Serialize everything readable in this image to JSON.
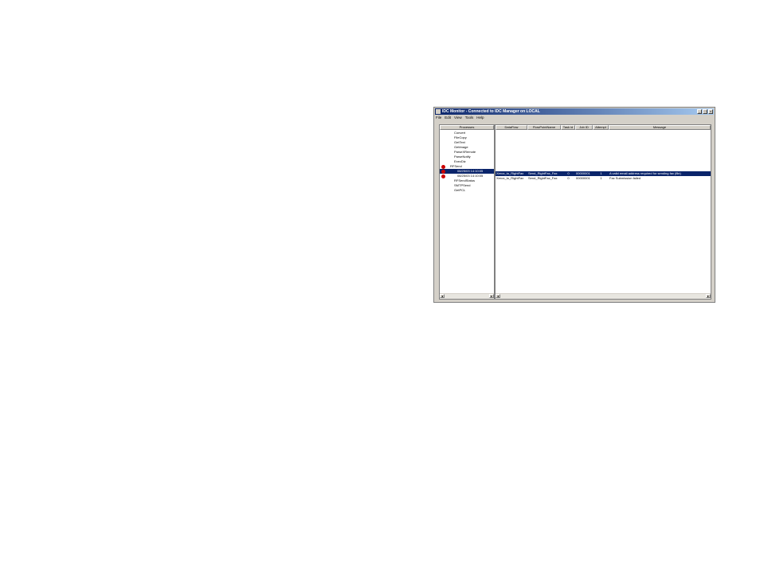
{
  "window": {
    "title": "IDC Monitor - Connected to IDC Manager on LOCAL",
    "controls": {
      "minimize": "_",
      "maximize": "□",
      "close": "x"
    }
  },
  "menu": [
    "File",
    "Edit",
    "View",
    "Tools",
    "Help"
  ],
  "left_pane": {
    "header": "Processes",
    "items": [
      "Convert",
      "FileCopy",
      "GetText",
      "GetImage",
      "ParseXRemote",
      "ParseNotify",
      "ExecDiz",
      "RFSend",
      "08/25/03 14:10:05",
      "08/25/03 14:10:05",
      "RFSendStatus",
      "SMTPSend",
      "GetPCL"
    ]
  },
  "right_pane": {
    "columns": [
      "DataFlow",
      "FlowPointName",
      "Task id",
      "Job ID",
      "Attempt",
      "Message"
    ],
    "rows": [
      [
        "Xerox_to_RightFax",
        "Send_RightFax_Fax",
        "0",
        "00000001",
        "1",
        "A valid email address required for sending fax (file)"
      ],
      [
        "Xerox_to_RightFax",
        "Send_RightFax_Fax",
        "0",
        "00000001",
        "1",
        "Fax Submission failed"
      ]
    ]
  },
  "colors": {
    "titlebar": "#0a246a",
    "selection": "#0a246a",
    "error": "#cc0000"
  },
  "scrollbar": {
    "left": "◂",
    "right": "▸"
  }
}
